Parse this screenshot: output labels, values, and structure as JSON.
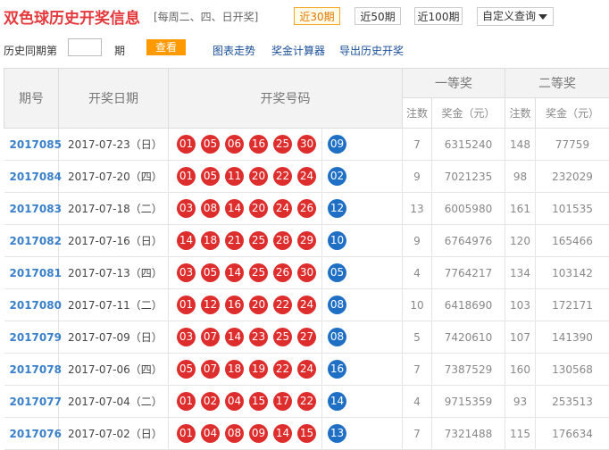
{
  "header": {
    "title": "双色球历史开奖信息",
    "subtitle": "[每周二、四、日开奖]",
    "period_buttons": [
      "近30期",
      "近50期",
      "近100期"
    ],
    "custom_select": "自定义查询"
  },
  "toolbar": {
    "history_label": "历史同期第",
    "period_suffix": "期",
    "query_button": "查看",
    "links": [
      "图表走势",
      "奖金计算器",
      "导出历史开奖"
    ]
  },
  "table": {
    "headers": {
      "issue": "期号",
      "date": "开奖日期",
      "numbers": "开奖号码",
      "first_prize": "一等奖",
      "second_prize": "二等奖",
      "count": "注数",
      "amount": "奖金（元）"
    },
    "rows": [
      {
        "issue": "2017085",
        "date": "2017-07-23（日）",
        "red": [
          "01",
          "05",
          "06",
          "16",
          "25",
          "30"
        ],
        "blue": "09",
        "c1": "7",
        "a1": "6315240",
        "c2": "148",
        "a2": "77759"
      },
      {
        "issue": "2017084",
        "date": "2017-07-20（四）",
        "red": [
          "01",
          "05",
          "11",
          "20",
          "22",
          "24"
        ],
        "blue": "02",
        "c1": "9",
        "a1": "7021235",
        "c2": "98",
        "a2": "232029"
      },
      {
        "issue": "2017083",
        "date": "2017-07-18（二）",
        "red": [
          "03",
          "08",
          "14",
          "20",
          "24",
          "26"
        ],
        "blue": "12",
        "c1": "13",
        "a1": "6005980",
        "c2": "161",
        "a2": "101535"
      },
      {
        "issue": "2017082",
        "date": "2017-07-16（日）",
        "red": [
          "14",
          "18",
          "21",
          "25",
          "28",
          "29"
        ],
        "blue": "10",
        "c1": "9",
        "a1": "6764976",
        "c2": "120",
        "a2": "165466"
      },
      {
        "issue": "2017081",
        "date": "2017-07-13（四）",
        "red": [
          "03",
          "05",
          "14",
          "25",
          "26",
          "30"
        ],
        "blue": "05",
        "c1": "4",
        "a1": "7764217",
        "c2": "134",
        "a2": "103142"
      },
      {
        "issue": "2017080",
        "date": "2017-07-11（二）",
        "red": [
          "01",
          "12",
          "16",
          "20",
          "22",
          "24"
        ],
        "blue": "08",
        "c1": "10",
        "a1": "6418690",
        "c2": "103",
        "a2": "172171"
      },
      {
        "issue": "2017079",
        "date": "2017-07-09（日）",
        "red": [
          "03",
          "07",
          "14",
          "23",
          "25",
          "27"
        ],
        "blue": "08",
        "c1": "5",
        "a1": "7420610",
        "c2": "107",
        "a2": "141390"
      },
      {
        "issue": "2017078",
        "date": "2017-07-06（四）",
        "red": [
          "05",
          "07",
          "18",
          "19",
          "22",
          "24"
        ],
        "blue": "16",
        "c1": "7",
        "a1": "7387529",
        "c2": "160",
        "a2": "130568"
      },
      {
        "issue": "2017077",
        "date": "2017-07-04（二）",
        "red": [
          "01",
          "02",
          "04",
          "15",
          "17",
          "22"
        ],
        "blue": "14",
        "c1": "4",
        "a1": "9715359",
        "c2": "93",
        "a2": "253513"
      },
      {
        "issue": "2017076",
        "date": "2017-07-02（日）",
        "red": [
          "01",
          "04",
          "08",
          "09",
          "14",
          "15"
        ],
        "blue": "13",
        "c1": "7",
        "a1": "7321488",
        "c2": "115",
        "a2": "176634"
      }
    ]
  }
}
